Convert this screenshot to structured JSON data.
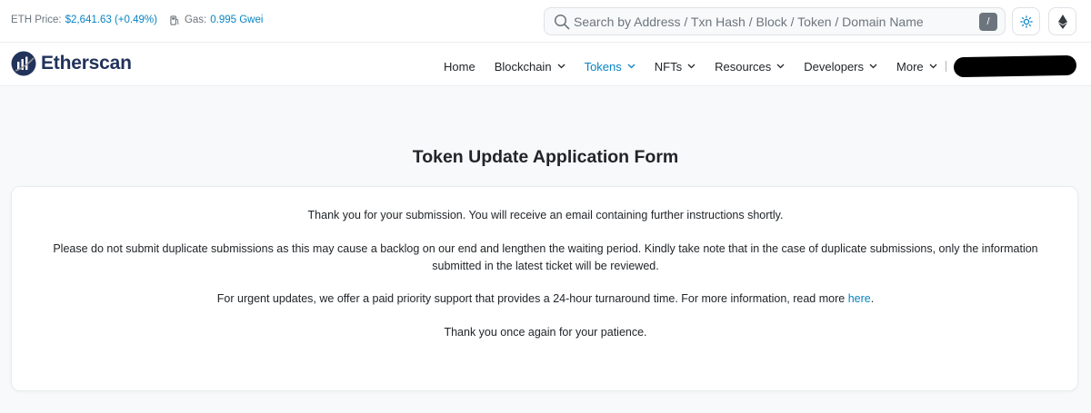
{
  "header": {
    "eth_price_label": "ETH Price:",
    "eth_price_value": "$2,641.63 (+0.49%)",
    "gas_label": "Gas:",
    "gas_value": "0.995 Gwei",
    "gas_icon": "gas-pump-icon",
    "search_placeholder": "Search by Address / Txn Hash / Block / Token / Domain Name",
    "search_shortcut": "/",
    "theme_icon": "sun-icon",
    "network_icon": "ethereum-icon"
  },
  "navbar": {
    "logo_text": "Etherscan",
    "items": [
      {
        "label": "Home",
        "dropdown": false,
        "active": false
      },
      {
        "label": "Blockchain",
        "dropdown": true,
        "active": false
      },
      {
        "label": "Tokens",
        "dropdown": true,
        "active": true
      },
      {
        "label": "NFTs",
        "dropdown": true,
        "active": false
      },
      {
        "label": "Resources",
        "dropdown": true,
        "active": false
      },
      {
        "label": "Developers",
        "dropdown": true,
        "active": false
      },
      {
        "label": "More",
        "dropdown": true,
        "active": false
      }
    ]
  },
  "main": {
    "title": "Token Update Application Form",
    "paragraph_1": "Thank you for your submission. You will receive an email containing further instructions shortly.",
    "paragraph_2_line_1": "Please do not submit duplicate submissions as this may cause a backlog on our end and lengthen the waiting period. Kindly take note that in the case of duplicate submissions, only the information",
    "paragraph_2_line_2": "submitted in the latest ticket will be reviewed.",
    "paragraph_3_text": "For urgent updates, we offer a paid priority support that provides a 24-hour turnaround time. For more information, read more",
    "paragraph_3_link": "here",
    "paragraph_3_end": ".",
    "paragraph_4": "Thank you once again for your patience."
  },
  "colors": {
    "accent": "#0784c3",
    "brand_dark": "#21325b",
    "background": "#f8f9fa"
  }
}
